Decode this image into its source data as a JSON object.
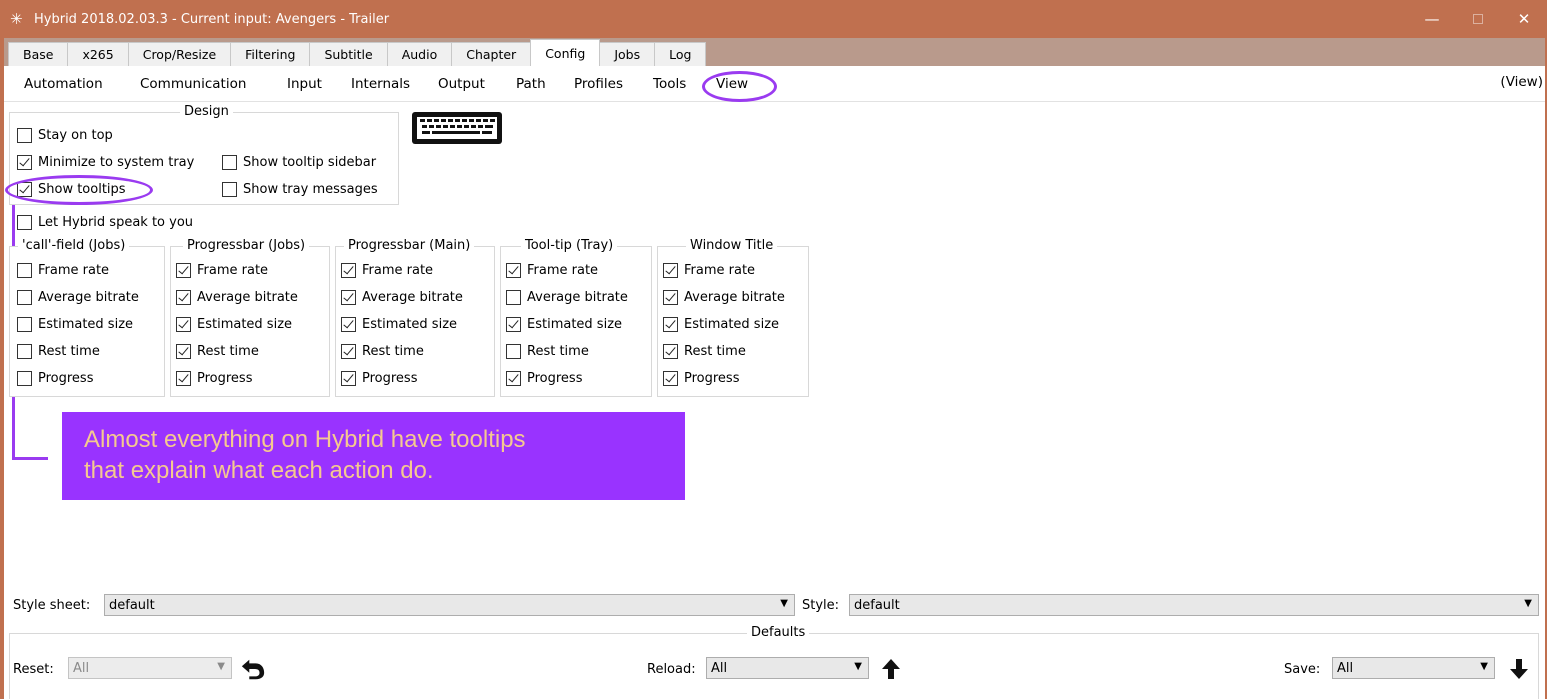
{
  "window": {
    "title": "Hybrid 2018.02.03.3 - Current input: Avengers - Trailer",
    "controls": {
      "minimize": "—",
      "maximize": "",
      "close": "✕"
    }
  },
  "tabs": [
    "Base",
    "x265",
    "Crop/Resize",
    "Filtering",
    "Subtitle",
    "Audio",
    "Chapter",
    "Config",
    "Jobs",
    "Log"
  ],
  "active_tab": "Config",
  "subtabs": [
    "Automation",
    "Communication",
    "Input",
    "Internals",
    "Output",
    "Path",
    "Profiles",
    "Tools",
    "View"
  ],
  "active_subtab": "View",
  "view_label": "(View)",
  "design": {
    "title": "Design",
    "stay_on_top": {
      "label": "Stay on top",
      "checked": false
    },
    "minimize_to_tray": {
      "label": "Minimize to system tray",
      "checked": true
    },
    "show_tooltip_sidebar": {
      "label": "Show tooltip sidebar",
      "checked": false
    },
    "show_tooltips": {
      "label": "Show tooltips",
      "checked": true
    },
    "show_tray_messages": {
      "label": "Show tray messages",
      "checked": false
    }
  },
  "let_hybrid_speak": {
    "label": "Let Hybrid speak to you",
    "checked": false
  },
  "groups": [
    {
      "title": "'call'-field (Jobs)",
      "items": [
        {
          "label": "Frame rate",
          "checked": false
        },
        {
          "label": "Average bitrate",
          "checked": false
        },
        {
          "label": "Estimated size",
          "checked": false
        },
        {
          "label": "Rest time",
          "checked": false
        },
        {
          "label": "Progress",
          "checked": false
        }
      ]
    },
    {
      "title": "Progressbar (Jobs)",
      "items": [
        {
          "label": "Frame rate",
          "checked": true
        },
        {
          "label": "Average bitrate",
          "checked": true
        },
        {
          "label": "Estimated size",
          "checked": true
        },
        {
          "label": "Rest time",
          "checked": true
        },
        {
          "label": "Progress",
          "checked": true
        }
      ]
    },
    {
      "title": "Progressbar (Main)",
      "items": [
        {
          "label": "Frame rate",
          "checked": true
        },
        {
          "label": "Average bitrate",
          "checked": true
        },
        {
          "label": "Estimated size",
          "checked": true
        },
        {
          "label": "Rest time",
          "checked": true
        },
        {
          "label": "Progress",
          "checked": true
        }
      ]
    },
    {
      "title": "Tool-tip (Tray)",
      "items": [
        {
          "label": "Frame rate",
          "checked": true
        },
        {
          "label": "Average bitrate",
          "checked": false
        },
        {
          "label": "Estimated size",
          "checked": true
        },
        {
          "label": "Rest time",
          "checked": false
        },
        {
          "label": "Progress",
          "checked": true
        }
      ]
    },
    {
      "title": "Window Title",
      "items": [
        {
          "label": "Frame rate",
          "checked": true
        },
        {
          "label": "Average bitrate",
          "checked": true
        },
        {
          "label": "Estimated size",
          "checked": true
        },
        {
          "label": "Rest time",
          "checked": true
        },
        {
          "label": "Progress",
          "checked": true
        }
      ]
    }
  ],
  "annotation": {
    "line1": "Almost everything on Hybrid have tooltips",
    "line2": "that explain what each action do.",
    "color": "#9933ff",
    "text_color": "#f5c98f"
  },
  "style_sheet": {
    "label": "Style sheet:",
    "value": "default"
  },
  "style": {
    "label": "Style:",
    "value": "default"
  },
  "defaults": {
    "title": "Defaults",
    "reset_label": "Reset:",
    "reset_value": "All",
    "reload_label": "Reload:",
    "reload_value": "All",
    "save_label": "Save:",
    "save_value": "All"
  },
  "colors": {
    "titlebar": "#c0704f",
    "annotation_purple": "#9a3bf0"
  }
}
